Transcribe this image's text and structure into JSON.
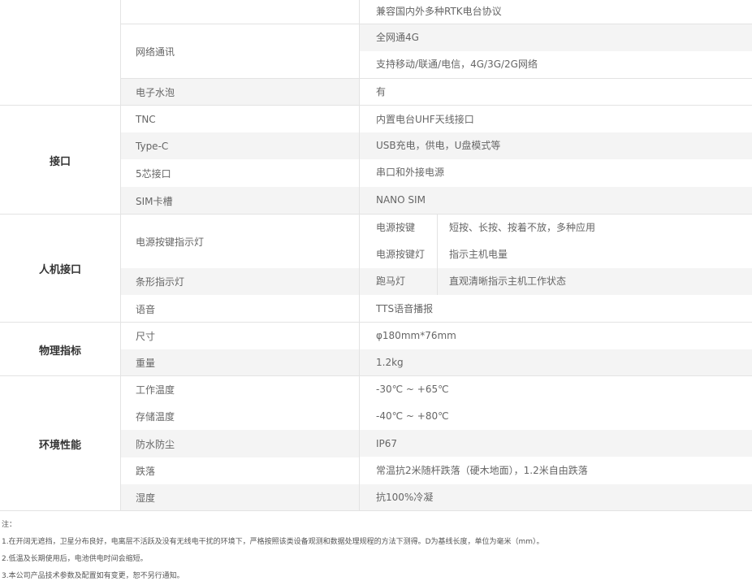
{
  "network": {
    "rtk_protocol": "兼容国内外多种RTK电台协议",
    "label": "网络通讯",
    "value1": "全网通4G",
    "value2": "支持移动/联通/电信，4G/3G/2G网络"
  },
  "bubble": {
    "label": "电子水泡",
    "value": "有"
  },
  "interface": {
    "category": "接口",
    "rows": [
      {
        "label": "TNC",
        "value": "内置电台UHF天线接口"
      },
      {
        "label": "Type-C",
        "value": "USB充电，供电，U盘模式等"
      },
      {
        "label": "5芯接口",
        "value": "串口和外接电源"
      },
      {
        "label": "SIM卡槽",
        "value": "NANO SIM"
      }
    ]
  },
  "hmi": {
    "category": "人机接口",
    "power": {
      "label": "电源按键指示灯",
      "sub": [
        {
          "name": "电源按键",
          "desc": "短按、长按、按着不放，多种应用"
        },
        {
          "name": "电源按键灯",
          "desc": "指示主机电量"
        }
      ]
    },
    "bar": {
      "label": "条形指示灯",
      "name": "跑马灯",
      "desc": "直观清晰指示主机工作状态"
    },
    "voice": {
      "label": "语音",
      "value": "TTS语音播报"
    }
  },
  "physical": {
    "category": "物理指标",
    "rows": [
      {
        "label": "尺寸",
        "value": "φ180mm*76mm"
      },
      {
        "label": "重量",
        "value": "1.2kg"
      }
    ]
  },
  "environment": {
    "category": "环境性能",
    "rows": [
      {
        "label": "工作温度",
        "value": "-30℃ ~ +65℃"
      },
      {
        "label": "存储温度",
        "value": "-40℃ ~ +80℃"
      },
      {
        "label": "防水防尘",
        "value": "IP67"
      },
      {
        "label": "跌落",
        "value": "常温抗2米随杆跌落（硬木地面），1.2米自由跌落"
      },
      {
        "label": "湿度",
        "value": "抗100%冷凝"
      }
    ]
  },
  "notes": {
    "title": "注：",
    "items": [
      "1.在开阔无遮挡，卫星分布良好，电离层不活跃及没有无线电干扰的环境下，严格按照该类设备观测和数据处理规程的方法下测得。D为基线长度，单位为毫米（mm）。",
      "2.低温及长期使用后，电池供电时间会缩短。",
      "3.本公司产品技术参数及配置如有变更，恕不另行通知。"
    ]
  },
  "colors": {
    "row_alt": "#f4f4f4",
    "border": "#e3e3e3",
    "text": "#666666",
    "category_text": "#333333"
  }
}
